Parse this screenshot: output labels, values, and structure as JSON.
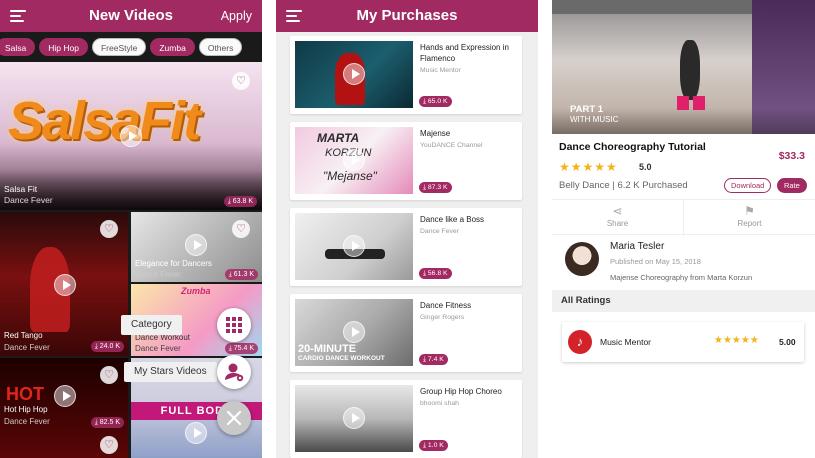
{
  "screen1": {
    "title": "New Videos",
    "apply_label": "Apply",
    "chips": [
      {
        "label": "Salsa",
        "state": "on"
      },
      {
        "label": "Hip Hop",
        "state": "on"
      },
      {
        "label": "FreeStyle",
        "state": "off"
      },
      {
        "label": "Zumba",
        "state": "on"
      },
      {
        "label": "Others",
        "state": "off"
      }
    ],
    "hero": {
      "image_text": "SalsaFit",
      "title": "Salsa Fit",
      "channel": "Dance Fever",
      "downloads": "63.8 K"
    },
    "tiles": [
      {
        "title": "Red Tango",
        "channel": "Dance Fever",
        "downloads": "24.0 K"
      },
      {
        "title": "Elegance for Dancers",
        "channel": "Dance Fever",
        "downloads": "61.3 K"
      },
      {
        "title": "Hot Hip Hop",
        "channel": "Dance Fever",
        "downloads": "82.5 K"
      },
      {
        "title": "Dance Workout",
        "channel": "Dance Fever",
        "downloads": "75.4 K",
        "image_text": "Zumba"
      },
      {
        "image_text": "FULL BODY"
      }
    ],
    "fab": {
      "category_label": "Category",
      "mystars_label": "My Stars Videos"
    }
  },
  "screen2": {
    "title": "My Purchases",
    "items": [
      {
        "title": "Hands and Expression in Flamenco",
        "channel": "Music Mentor",
        "price": "65.0 K"
      },
      {
        "title": "Majense",
        "channel": "YouDANCE Channel",
        "price": "87.3 K",
        "thumb_text1": "MARTA",
        "thumb_text2": "KORZUN",
        "thumb_text3": "\"Mejanse\""
      },
      {
        "title": "Dance like a Boss",
        "channel": "Dance Fever",
        "price": "56.8 K"
      },
      {
        "title": "Dance Fitness",
        "channel": "Ginger Rogers",
        "price": "7.4 K",
        "thumb_text1": "20-MINUTE",
        "thumb_text2": "CARDIO DANCE WORKOUT"
      },
      {
        "title": "Group Hip Hop Choreo",
        "channel": "bhoomi shah",
        "price": "1.0 K"
      }
    ]
  },
  "screen3": {
    "video": {
      "part": "PART 1",
      "sub": "WITH MUSIC"
    },
    "title": "Dance Choreography Tutorial",
    "price": "$33.3",
    "stars": "★★★★★",
    "rating": "5.0",
    "meta": "Belly Dance  |  6.2 K Purchased",
    "download_label": "Download",
    "rate_label": "Rate",
    "share_label": "Share",
    "report_label": "Report",
    "author": {
      "name": "Maria Tesler",
      "published": "Published on May 15, 2018",
      "desc": "Majense Choreography from Marta Korzun"
    },
    "all_ratings_label": "All Ratings",
    "review": {
      "name": "Music Mentor",
      "stars": "★★★★★",
      "value": "5.00"
    }
  },
  "colors": {
    "brand": "#a22a62",
    "star": "#f2b418"
  }
}
